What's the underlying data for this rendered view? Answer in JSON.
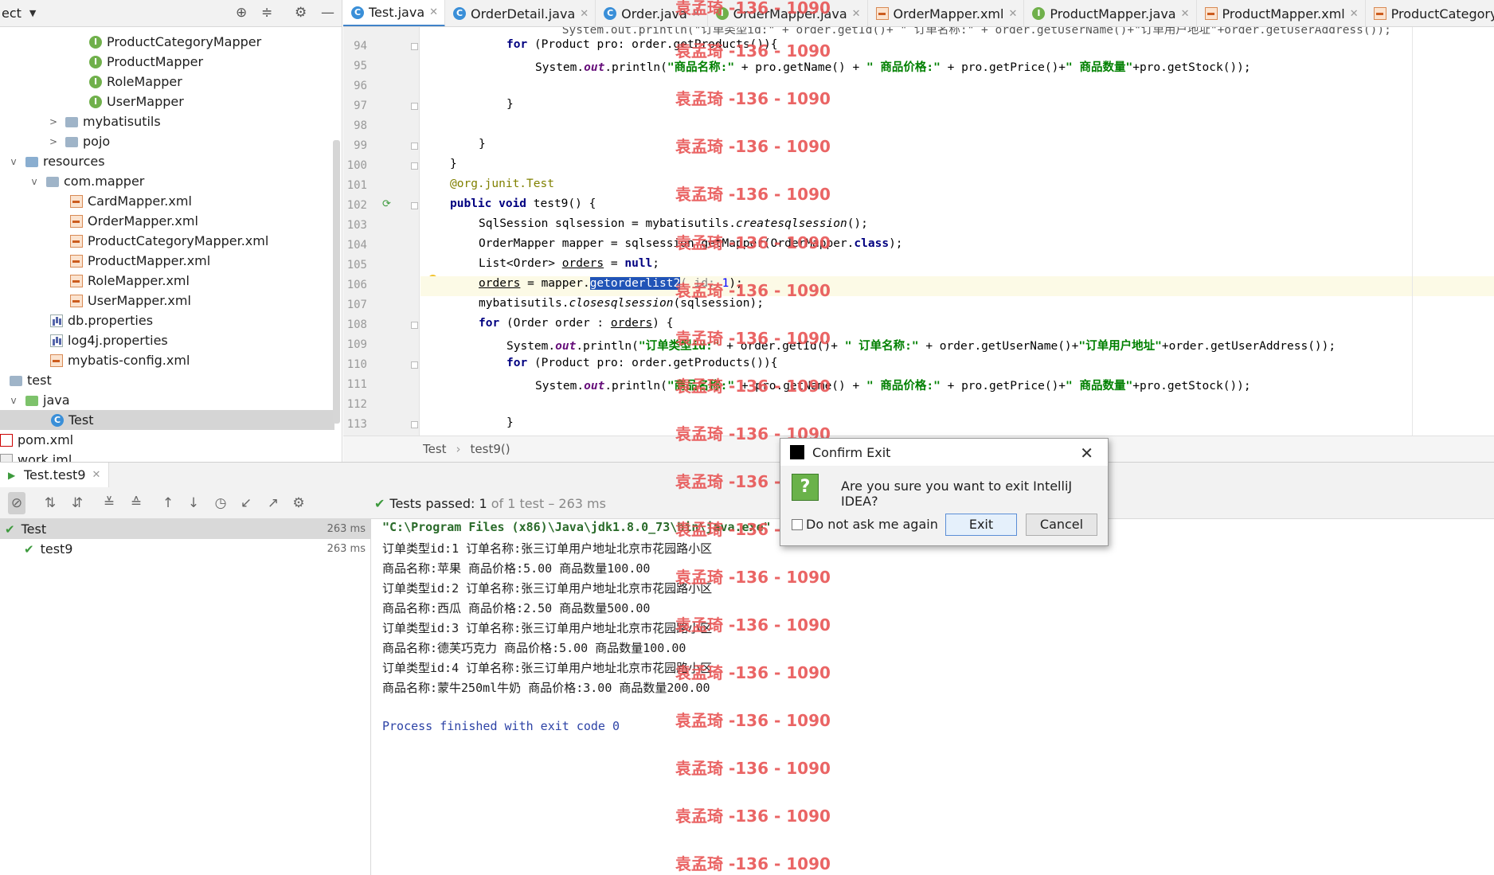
{
  "project": {
    "title": "ect",
    "tree": [
      {
        "label": "ProductCategoryMapper",
        "icon": "interface-icon"
      },
      {
        "label": "ProductMapper",
        "icon": "interface-icon"
      },
      {
        "label": "RoleMapper",
        "icon": "interface-icon"
      },
      {
        "label": "UserMapper",
        "icon": "interface-icon"
      },
      {
        "label": "mybatisutils",
        "icon": "folder-icon"
      },
      {
        "label": "pojo",
        "icon": "folder-icon"
      },
      {
        "label": "resources",
        "icon": "resources-folder-icon"
      },
      {
        "label": "com.mapper",
        "icon": "folder-icon"
      },
      {
        "label": "CardMapper.xml",
        "icon": "xml-file-icon"
      },
      {
        "label": "OrderMapper.xml",
        "icon": "xml-file-icon"
      },
      {
        "label": "ProductCategoryMapper.xml",
        "icon": "xml-file-icon"
      },
      {
        "label": "ProductMapper.xml",
        "icon": "xml-file-icon"
      },
      {
        "label": "RoleMapper.xml",
        "icon": "xml-file-icon"
      },
      {
        "label": "UserMapper.xml",
        "icon": "xml-file-icon"
      },
      {
        "label": "db.properties",
        "icon": "properties-file-icon"
      },
      {
        "label": "log4j.properties",
        "icon": "properties-file-icon"
      },
      {
        "label": "mybatis-config.xml",
        "icon": "xml-file-icon"
      },
      {
        "label": "test",
        "icon": "folder-icon"
      },
      {
        "label": "java",
        "icon": "test-source-folder-icon"
      },
      {
        "label": "Test",
        "icon": "class-icon"
      },
      {
        "label": "pom.xml",
        "icon": "maven-icon"
      },
      {
        "label": "work.iml",
        "icon": "iml-file-icon"
      }
    ]
  },
  "tabs": [
    {
      "label": "Test.java",
      "icon": "class-icon",
      "active": true
    },
    {
      "label": "OrderDetail.java",
      "icon": "class-icon"
    },
    {
      "label": "Order.java",
      "icon": "class-icon"
    },
    {
      "label": "OrderMapper.java",
      "icon": "interface-icon"
    },
    {
      "label": "OrderMapper.xml",
      "icon": "xml-file-icon"
    },
    {
      "label": "ProductMapper.java",
      "icon": "interface-icon"
    },
    {
      "label": "ProductMapper.xml",
      "icon": "xml-file-icon"
    },
    {
      "label": "ProductCategoryMapper",
      "icon": "xml-file-icon"
    }
  ],
  "editor": {
    "line_numbers": [
      "94",
      "95",
      "96",
      "97",
      "98",
      "99",
      "100",
      "101",
      "102",
      "103",
      "104",
      "105",
      "106",
      "107",
      "108",
      "109",
      "110",
      "111",
      "112",
      "113"
    ],
    "code": {
      "l93": "            System.out.println(\"订单类型id:\" + order.getId()+ \" 订单名称:\" + order.getUserName()+\"订单用户地址\"+order.getUserAddress());",
      "l94_kw": "for",
      "l94": " (Product pro: order.getProducts()){",
      "l95_a": "System.",
      "l95_fld": "out",
      "l95_b": ".println(",
      "l95_s1": "\"商品名称:\"",
      "l95_c": " + pro.getName() + ",
      "l95_s2": "\" 商品价格:\"",
      "l95_d": " + pro.getPrice()+",
      "l95_s3": "\" 商品数量\"",
      "l95_e": "+pro.getStock());",
      "l97": "}",
      "l99": "}",
      "l100": "}",
      "l101_ann": "@org.junit.",
      "l101_test": "Test",
      "l102_kw": "public void",
      "l102": " test9() {",
      "l103_a": "SqlSession sqlsession = mybatisutils.",
      "l103_it": "createsqlsession",
      "l103_b": "();",
      "l104_a": "OrderMapper mapper = sqlsession.getMapper(OrderMapper.",
      "l104_kw": "class",
      "l104_b": ");",
      "l105_a": "List<Order> ",
      "l105_ul": "orders",
      "l105_b": " = ",
      "l105_kw": "null",
      "l105_c": ";",
      "l106_ul": "orders",
      "l106_a": " = mapper.",
      "l106_hl": "getorderlist2",
      "l106_b": "( id: ",
      "l106_num": "1",
      "l106_c": ");",
      "l107_a": "mybatisutils.",
      "l107_it": "closesqlsession",
      "l107_b": "(sqlsession);",
      "l108_kw": "for",
      "l108_a": " (Order order : ",
      "l108_ul": "orders",
      "l108_b": ") {",
      "l109_a": "System.",
      "l109_fld": "out",
      "l109_b": ".println(",
      "l109_s1": "\"订单类型id:\"",
      "l109_c": " + order.getId()+ ",
      "l109_s2": "\" 订单名称:\"",
      "l109_d": " + order.getUserName()+",
      "l109_s3": "\"订单用户地址\"",
      "l109_e": "+order.getUserAddress());",
      "l110_kw": "for",
      "l110": " (Product pro: order.getProducts()){",
      "l111_a": "System.",
      "l111_fld": "out",
      "l111_b": ".println(",
      "l111_s1": "\"商品名称:\"",
      "l111_c": " + pro.getName() + ",
      "l111_s2": "\" 商品价格:\"",
      "l111_d": " + pro.getPrice()+",
      "l111_s3": "\" 商品数量\"",
      "l111_e": "+pro.getStock());",
      "l113": "}"
    },
    "breadcrumb": [
      "Test",
      "test9()"
    ]
  },
  "run": {
    "tab_label": "Test.test9",
    "passed_label": "Tests passed:",
    "passed_count": "1",
    "passed_detail": "of 1 test – 263 ms",
    "tree": [
      {
        "label": "Test",
        "time": "263 ms"
      },
      {
        "label": "test9",
        "time": "263 ms"
      }
    ],
    "console": [
      "\"C:\\Program Files (x86)\\Java\\jdk1.8.0_73\\bin\\java.exe\" ...",
      "订单类型id:1 订单名称:张三订单用户地址北京市花园路小区",
      "商品名称:苹果 商品价格:5.00 商品数量100.00",
      "订单类型id:2 订单名称:张三订单用户地址北京市花园路小区",
      "商品名称:西瓜 商品价格:2.50 商品数量500.00",
      "订单类型id:3 订单名称:张三订单用户地址北京市花园路小区",
      "商品名称:德芙巧克力 商品价格:5.00 商品数量100.00",
      "订单类型id:4 订单名称:张三订单用户地址北京市花园路小区",
      "商品名称:蒙牛250ml牛奶 商品价格:3.00 商品数量200.00",
      "",
      "Process finished with exit code 0"
    ]
  },
  "dialog": {
    "title": "Confirm Exit",
    "message": "Are you sure you want to exit IntelliJ IDEA?",
    "checkbox_label": "Do not ask me again",
    "exit_label": "Exit",
    "cancel_label": "Cancel"
  },
  "watermark": "袁孟琦 -136 - 1090"
}
